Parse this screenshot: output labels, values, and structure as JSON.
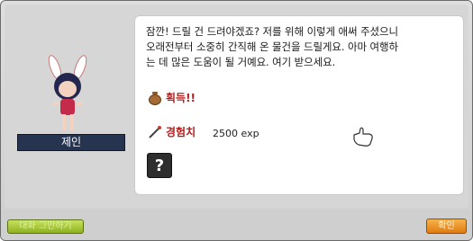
{
  "npc": {
    "name": "제인"
  },
  "dialog": {
    "lines": [
      "잠깐! 드릴 건 드려야겠죠? 저를 위해 이렇게 애써 주셨으니",
      "오래전부터 소중히 간직해 온 물건을 드릴게요. 아마 여행하",
      "는 데 많은 도움이 될 거예요. 여기 받으세요."
    ],
    "acquire_label": "획득!!",
    "exp_label": "경험치",
    "exp_value": "2500 exp"
  },
  "buttons": {
    "chat_label": "대화 그만하기",
    "ok_label": "확인"
  },
  "icons": {
    "bag": "money-bag-icon",
    "exp": "exp-needle-icon",
    "reward": "question-box-icon",
    "cursor": "hand-cursor-icon"
  },
  "colors": {
    "nameplate": "#27344f",
    "label_red": "#b61d1d",
    "ok_button": "#e88a1e",
    "chat_button": "#a8c83a"
  }
}
